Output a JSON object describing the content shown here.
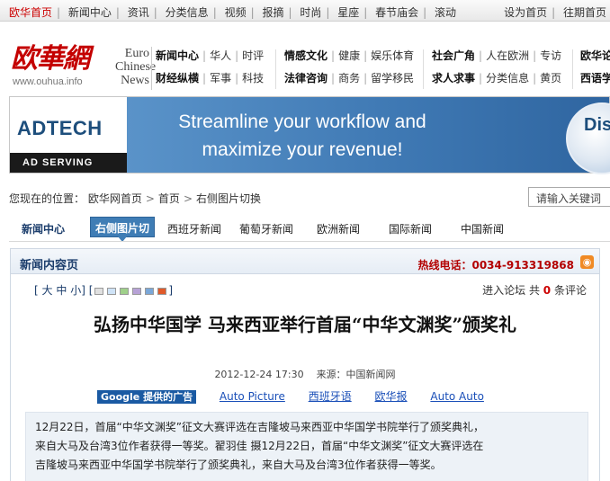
{
  "topbar": {
    "left": [
      "欧华首页",
      "新闻中心",
      "资讯",
      "分类信息",
      "视频",
      "报摘",
      "时尚",
      "星座",
      "春节庙会",
      "滚动"
    ],
    "right": [
      "设为首页",
      "往期首页"
    ]
  },
  "logo": {
    "cn": "欧華網",
    "url": "www.ouhua.info",
    "en_lines": [
      "Euro",
      "Chinese",
      "News"
    ]
  },
  "header_nav": {
    "col1": [
      [
        "新闻中心",
        "华人",
        "时评"
      ],
      [
        "财经纵横",
        "军事",
        "科技"
      ]
    ],
    "col2": [
      [
        "情感文化",
        "健康",
        "娱乐体育"
      ],
      [
        "法律咨询",
        "商务",
        "留学移民"
      ]
    ],
    "col3": [
      [
        "社会广角",
        "人在欧洲",
        "专访"
      ],
      [
        "求人求事",
        "分类信息",
        "黄页"
      ]
    ],
    "col4": [
      [
        "欧华论"
      ],
      [
        "西语学"
      ]
    ]
  },
  "banner": {
    "brand": "ADTECH",
    "tagline": "AD SERVING",
    "headline_1": "Streamline your workflow and",
    "headline_2": "maximize your revenue!",
    "disc_text": "Dis"
  },
  "breadcrumb": {
    "prefix": "您现在的位置：",
    "items": [
      "欧华网首页",
      "首页",
      "右侧图片切换"
    ],
    "separator": ">"
  },
  "search": {
    "placeholder": "请输入关键词"
  },
  "tabs": [
    "新闻中心",
    "右侧图片切",
    "西班牙新闻",
    "葡萄牙新闻",
    "欧洲新闻",
    "国际新闻",
    "中国新闻"
  ],
  "content": {
    "section_title": "新闻内容页",
    "hotline": "热线电话：0034-913319868",
    "fontsize": {
      "open": "[",
      "large": "大",
      "medium": "中",
      "small": "小",
      "mid": "] [",
      "close": "]"
    },
    "swatch_colors": [
      "#e0e0e0",
      "#cfe3f7",
      "#9fd08a",
      "#b7a2d6",
      "#7aa7d8",
      "#e05a2a"
    ],
    "forum": {
      "label": "进入论坛",
      "count_prefix": "共",
      "count": "0",
      "count_suffix": "条评论"
    },
    "headline": "弘扬中华国学  马来西亚举行首届“中华文渊奖”颁奖礼",
    "date": "2012-12-24 17:30",
    "source": "来源：中国新闻网",
    "ads_label": "Google 提供的广告",
    "ad_links": [
      "Auto Picture",
      "西班牙语",
      "欧华报",
      "Auto Auto"
    ],
    "body_lines": [
      "12月22日，首届“中华文渊奖”征文大赛评选在吉隆坡马来西亚中华国学书院举行了颁奖典礼，",
      "来自大马及台湾3位作者获得一等奖。翟羽佳  摄12月22日，首届“中华文渊奖”征文大赛评选在",
      "吉隆坡马来西亚中华国学书院举行了颁奖典礼，来自大马及台湾3位作者获得一等奖。"
    ]
  }
}
